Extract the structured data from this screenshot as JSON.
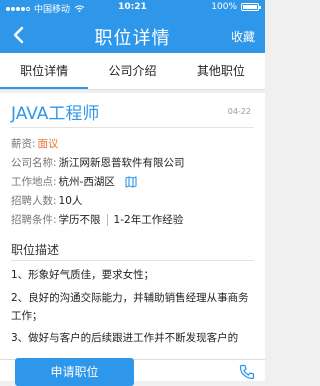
{
  "status_bar": {
    "carrier": "中国移动",
    "time": "10:21",
    "battery": "100%"
  },
  "nav": {
    "title": "职位详情",
    "favorite": "收藏"
  },
  "tabs": [
    {
      "label": "职位详情",
      "active": true
    },
    {
      "label": "公司介绍",
      "active": false
    },
    {
      "label": "其他职位",
      "active": false
    }
  ],
  "job": {
    "title": "JAVA工程师",
    "date": "04-22",
    "salary_label": "薪资:",
    "salary_value": "面议",
    "company_label": "公司名称:",
    "company_value": "浙江网新恩普软件有限公司",
    "location_label": "工作地点:",
    "location_value": "杭州-西湖区",
    "headcount_label": "招聘人数:",
    "headcount_value": "10人",
    "conditions_label": "招聘条件:",
    "education": "学历不限",
    "experience": "1-2年工作经验"
  },
  "description": {
    "heading": "职位描述",
    "lines": [
      "1、形象好气质佳，要求女性；",
      "2、良好的沟通交际能力，并辅助销售经理从事商务工作；",
      "3、做好与客户的后续跟进工作并不断发现客户的"
    ]
  },
  "actions": {
    "apply": "申请职位"
  },
  "colors": {
    "primary": "#2f97ea",
    "salary": "#e8753a"
  }
}
